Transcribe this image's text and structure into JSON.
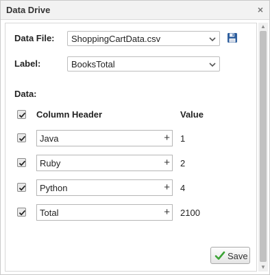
{
  "dialog": {
    "title": "Data Drive",
    "close_glyph": "×"
  },
  "form": {
    "data_file_label": "Data File:",
    "data_file_value": "ShoppingCartData.csv",
    "label_label": "Label:",
    "label_value": "BooksTotal",
    "data_label": "Data:"
  },
  "table": {
    "column_header": "Column Header",
    "value_header": "Value",
    "header_checked": true,
    "rows": [
      {
        "column": "Java",
        "value": "1",
        "checked": true
      },
      {
        "column": "Ruby",
        "value": "2",
        "checked": true
      },
      {
        "column": "Python",
        "value": "4",
        "checked": true
      },
      {
        "column": "Total",
        "value": "2100",
        "checked": true
      }
    ],
    "add_glyph": "+"
  },
  "actions": {
    "save_label": "Save"
  },
  "icons": {
    "close": "close-icon",
    "dropdown": "chevron-down-icon",
    "file_save": "floppy-disk-icon",
    "checkbox": "checkbox-checked-icon",
    "save_check": "checkmark-icon"
  },
  "colors": {
    "save_check": "#3aa335",
    "floppy": "#2f5f9e"
  }
}
